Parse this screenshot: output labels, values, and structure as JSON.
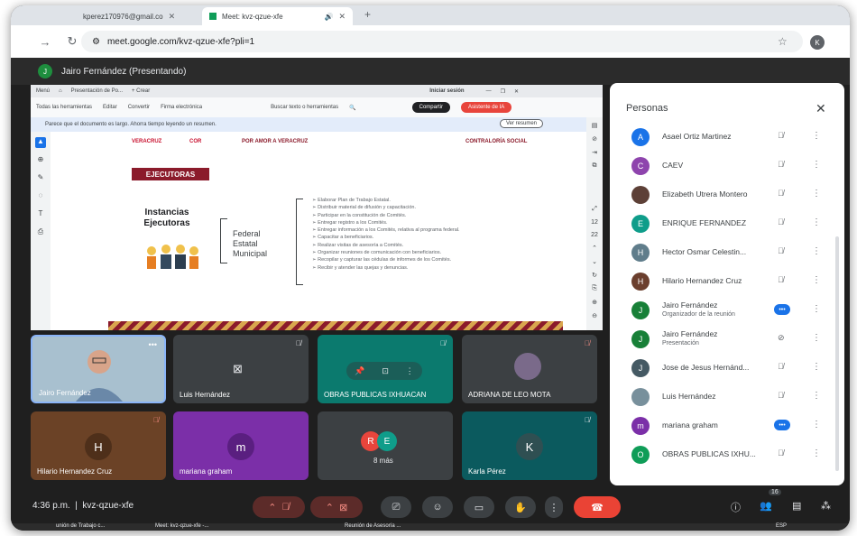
{
  "browser": {
    "tabs": [
      {
        "label": "kperez170976@gmail.co",
        "close": "✕"
      },
      {
        "label": "Meet: kvz-qzue-xfe",
        "close": "✕"
      }
    ],
    "new_tab": "+",
    "url": "meet.google.com/kvz-qzue-xfe?pli=1",
    "profile_initial": "K"
  },
  "meet": {
    "presenter_banner": "Jairo Fernández (Presentando)",
    "presenter_initial": "J",
    "meeting_code": "kvz-qzue-xfe",
    "time": "4:36 p.m."
  },
  "presentation": {
    "tabs": [
      "Menú",
      "Presentación de Po...",
      "+ Crear",
      "Iniciar sesión"
    ],
    "menu": [
      "Todas las herramientas",
      "Editar",
      "Convertir",
      "Firma electrónica"
    ],
    "search_text": "Buscar texto o herramientas",
    "share_label": "Compartir",
    "ai_label": "Asistente de IA",
    "banner_text": "Parece que el documento es largo. Ahorra tiempo leyendo un resumen.",
    "summary_button": "Ver resumen",
    "page_number": "12",
    "page_total": "22",
    "slide": {
      "logos": [
        "VERACRUZ",
        "COR",
        "POR AMOR A VERACRUZ",
        "CONTRALORÍA SOCIAL"
      ],
      "section_title": "EJECUTORAS",
      "heading": "Instancias Ejecutoras",
      "levels": [
        "Federal",
        "Estatal",
        "Municipal"
      ],
      "bullets": [
        "Elaborar Plan de Trabajo Estatal.",
        "Distribuir material de difusión y capacitación.",
        "Participar en la constitución de Comités.",
        "Entregar registro a los Comités.",
        "Entregar información a los Comités, relativa al programa federal.",
        "Capacitar a beneficiarios.",
        "Realizar visitas de asesoría a Comités.",
        "Organizar reuniones de comunicación con beneficiarios.",
        "Recopilar y capturar las cédulas de informes de los Comités.",
        "Recibir y atender las quejas y denuncias."
      ]
    }
  },
  "tiles": [
    {
      "name": "Jairo Fernández",
      "initial": "",
      "color": "#a8c0cf"
    },
    {
      "name": "Luis Hernández",
      "initial": "",
      "color": "#3c4043"
    },
    {
      "name": "OBRAS PUBLICAS IXHUACAN",
      "initial": "",
      "color": "#0b7a6e"
    },
    {
      "name": "ADRIANA DE LEO MOTA",
      "initial": "",
      "color": "#3c4043"
    },
    {
      "name": "Hilario Hernandez Cruz",
      "initial": "H",
      "color": "#6b4226"
    },
    {
      "name": "mariana graham",
      "initial": "m",
      "color": "#7b2fa8"
    },
    {
      "name": "8 más",
      "initial": "",
      "color": "#3c4043"
    },
    {
      "name": "Karla Pérez",
      "initial": "K",
      "color": "#0b5a5e"
    }
  ],
  "more_initials": [
    "R",
    "E"
  ],
  "people_panel": {
    "title": "Personas",
    "participants": [
      {
        "initial": "A",
        "name": "Asael Ortiz Martinez",
        "sub": "",
        "color": "#1a73e8"
      },
      {
        "initial": "C",
        "name": "CAEV",
        "sub": "",
        "color": "#8e44ad"
      },
      {
        "initial": "",
        "name": "Elizabeth Utrera Montero",
        "sub": "",
        "color": "#5d4037"
      },
      {
        "initial": "E",
        "name": "ENRIQUE FERNANDEZ",
        "sub": "",
        "color": "#0f9d8a"
      },
      {
        "initial": "H",
        "name": "Hector Osmar Celestin...",
        "sub": "",
        "color": "#607d8b"
      },
      {
        "initial": "H",
        "name": "Hilario Hernandez Cruz",
        "sub": "",
        "color": "#6b3f2e"
      },
      {
        "initial": "J",
        "name": "Jairo Fernández",
        "sub": "Organizador de la reunión",
        "color": "#188038"
      },
      {
        "initial": "J",
        "name": "Jairo Fernández",
        "sub": "Presentación",
        "color": "#188038"
      },
      {
        "initial": "J",
        "name": "Jose de Jesus Hernánd...",
        "sub": "",
        "color": "#455a64"
      },
      {
        "initial": "",
        "name": "Luis Hernández",
        "sub": "",
        "color": "#78909c"
      },
      {
        "initial": "m",
        "name": "mariana graham",
        "sub": "",
        "color": "#7b2fa8"
      },
      {
        "initial": "O",
        "name": "OBRAS PUBLICAS IXHU...",
        "sub": "",
        "color": "#0f9d58"
      }
    ]
  },
  "controls": {
    "participants_count": "16",
    "end_call_icon": "phone-hangup-icon"
  },
  "taskbar": {
    "items": [
      "unión de Trabajo c...",
      "Meet: kvz-qzue-xfe -...",
      "Reunión de Asesoría ..."
    ],
    "lang": "ESP"
  }
}
